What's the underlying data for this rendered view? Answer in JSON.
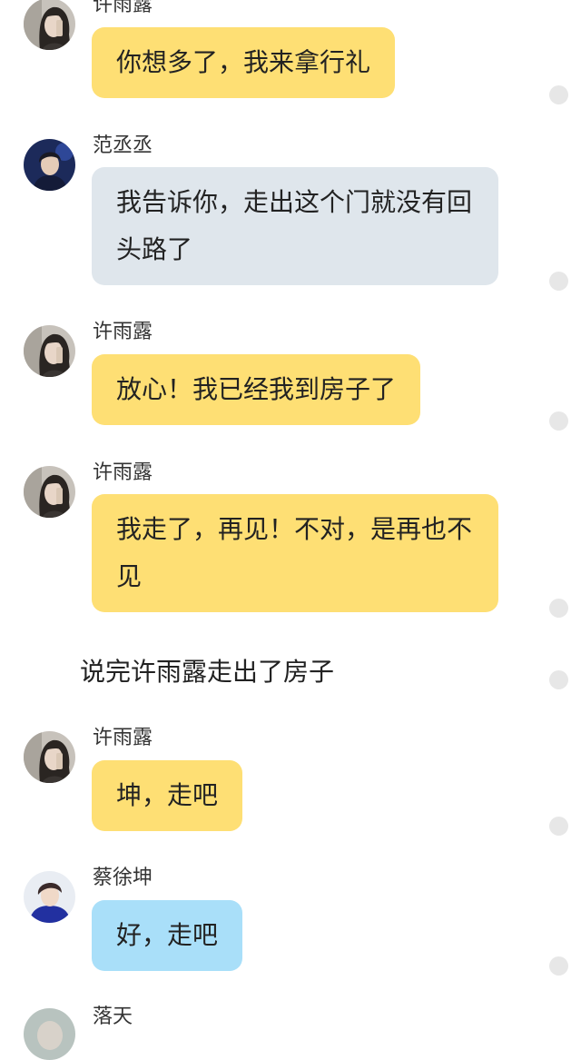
{
  "messages": [
    {
      "name": "许雨露",
      "text": "你想多了，我来拿行礼",
      "avatar_icon": "girl-avatar-icon",
      "bubble_color": "#fedf74"
    },
    {
      "name": "范丞丞",
      "text": "我告诉你，走出这个门就没有回头路了",
      "avatar_icon": "boy-avatar-icon",
      "bubble_color": "#dfe6ec"
    },
    {
      "name": "许雨露",
      "text": "放心！我已经我到房子了",
      "avatar_icon": "girl-avatar-icon",
      "bubble_color": "#fedf74"
    },
    {
      "name": "许雨露",
      "text": "我走了，再见！不对，是再也不见",
      "avatar_icon": "girl-avatar-icon",
      "bubble_color": "#fedf74"
    },
    {
      "name": "许雨露",
      "text": "坤，走吧",
      "avatar_icon": "girl-avatar-icon",
      "bubble_color": "#fedf74"
    },
    {
      "name": "蔡徐坤",
      "text": "好，走吧",
      "avatar_icon": "boy-avatar-icon",
      "bubble_color": "#a9dff9"
    },
    {
      "name": "落天",
      "avatar_icon": "avatar-icon"
    }
  ],
  "narration": "说完许雨露走出了房子",
  "colors": {
    "yellow_bubble": "#fedf74",
    "gray_bubble": "#dfe6ec",
    "blue_bubble": "#a9dff9",
    "dot": "#e7e7e7"
  }
}
